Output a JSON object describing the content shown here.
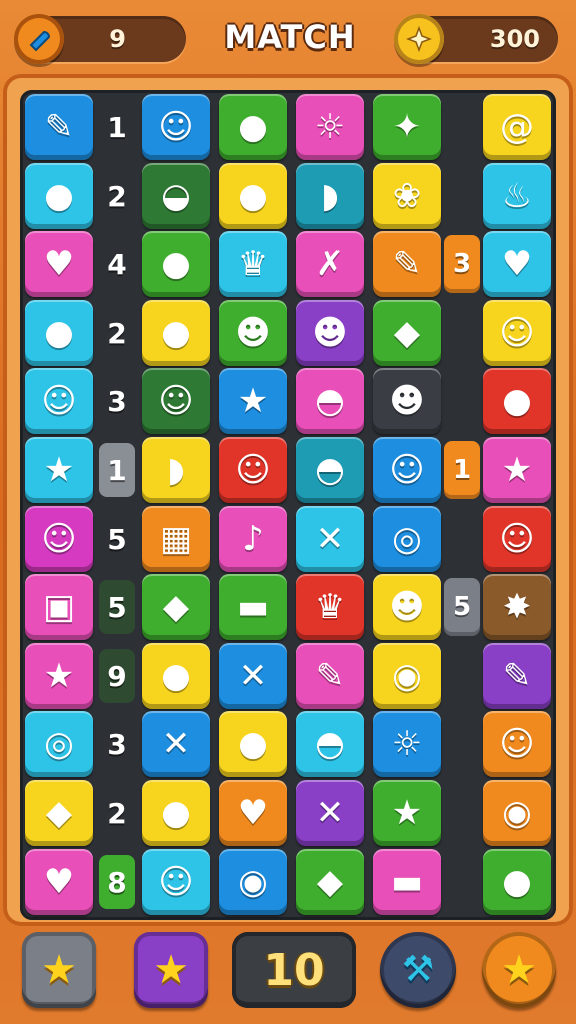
{
  "header": {
    "title": "MATCH",
    "moves_value": "9",
    "moves_icon": "wrench-icon",
    "coins_value": "300",
    "coins_icon": "coin-icon"
  },
  "colors": {
    "blue": "#1e8fe0",
    "cyan": "#2ec4e8",
    "green": "#3fae2e",
    "yellow": "#f7d41e",
    "pink": "#e94fb8",
    "magenta": "#d63ac0",
    "purple": "#8a3fc7",
    "red": "#e2352a",
    "orange": "#f08a1e",
    "darkgreen": "#2e7a34",
    "teal": "#1e9cb4",
    "dark": "#3a3e44",
    "brown": "#8a5a2a"
  },
  "board": {
    "rows": [
      {
        "tiles": [
          {
            "c": "blue",
            "g": "✎"
          },
          {
            "c": "blue",
            "g": "☺"
          },
          {
            "c": "green",
            "g": "●"
          },
          {
            "c": "pink",
            "g": "☼"
          },
          {
            "c": "green",
            "g": "✦"
          },
          {
            "c": "yellow",
            "g": "@"
          }
        ],
        "hint": "1",
        "chip": ""
      },
      {
        "tiles": [
          {
            "c": "cyan",
            "g": "●"
          },
          {
            "c": "darkgreen",
            "g": "◒"
          },
          {
            "c": "yellow",
            "g": "●"
          },
          {
            "c": "teal",
            "g": "◗"
          },
          {
            "c": "yellow",
            "g": "❀"
          },
          {
            "c": "cyan",
            "g": "♨"
          }
        ],
        "hint": "2",
        "chip": ""
      },
      {
        "tiles": [
          {
            "c": "pink",
            "g": "♥"
          },
          {
            "c": "green",
            "g": "●"
          },
          {
            "c": "cyan",
            "g": "♛"
          },
          {
            "c": "pink",
            "g": "✗"
          },
          {
            "c": "orange",
            "g": "✎"
          },
          {
            "c": "cyan",
            "g": "♥"
          }
        ],
        "hint": "4",
        "chip": "3"
      },
      {
        "tiles": [
          {
            "c": "cyan",
            "g": "●"
          },
          {
            "c": "yellow",
            "g": "●"
          },
          {
            "c": "green",
            "g": "☻"
          },
          {
            "c": "purple",
            "g": "☻"
          },
          {
            "c": "green",
            "g": "◆"
          },
          {
            "c": "yellow",
            "g": "☺"
          }
        ],
        "hint": "2",
        "chip": ""
      },
      {
        "tiles": [
          {
            "c": "cyan",
            "g": "☺"
          },
          {
            "c": "darkgreen",
            "g": "☺"
          },
          {
            "c": "blue",
            "g": "★"
          },
          {
            "c": "pink",
            "g": "◓"
          },
          {
            "c": "dark",
            "g": "☻"
          },
          {
            "c": "red",
            "g": "●"
          }
        ],
        "hint": "3",
        "chip": ""
      },
      {
        "tiles": [
          {
            "c": "cyan",
            "g": "★"
          },
          {
            "c": "yellow",
            "g": "◗"
          },
          {
            "c": "red",
            "g": "☺"
          },
          {
            "c": "teal",
            "g": "◓"
          },
          {
            "c": "blue",
            "g": "☺"
          },
          {
            "c": "pink",
            "g": "★"
          }
        ],
        "hint": "1",
        "chip": "1"
      },
      {
        "tiles": [
          {
            "c": "magenta",
            "g": "☺"
          },
          {
            "c": "orange",
            "g": "▦"
          },
          {
            "c": "pink",
            "g": "♪"
          },
          {
            "c": "cyan",
            "g": "✕"
          },
          {
            "c": "blue",
            "g": "◎"
          },
          {
            "c": "red",
            "g": "☺"
          }
        ],
        "hint": "5",
        "chip": ""
      },
      {
        "tiles": [
          {
            "c": "pink",
            "g": "▣"
          },
          {
            "c": "green",
            "g": "◆"
          },
          {
            "c": "green",
            "g": "▬"
          },
          {
            "c": "red",
            "g": "♛"
          },
          {
            "c": "yellow",
            "g": "☻"
          },
          {
            "c": "brown",
            "g": "✸"
          }
        ],
        "hint": "5",
        "chip": "5"
      },
      {
        "tiles": [
          {
            "c": "pink",
            "g": "★"
          },
          {
            "c": "yellow",
            "g": "●"
          },
          {
            "c": "blue",
            "g": "✕"
          },
          {
            "c": "pink",
            "g": "✎"
          },
          {
            "c": "yellow",
            "g": "◉"
          },
          {
            "c": "purple",
            "g": "✎"
          }
        ],
        "hint": "9",
        "chip": ""
      },
      {
        "tiles": [
          {
            "c": "cyan",
            "g": "◎"
          },
          {
            "c": "blue",
            "g": "✕"
          },
          {
            "c": "yellow",
            "g": "●"
          },
          {
            "c": "cyan",
            "g": "◓"
          },
          {
            "c": "blue",
            "g": "☼"
          },
          {
            "c": "orange",
            "g": "☺"
          }
        ],
        "hint": "3",
        "chip": ""
      },
      {
        "tiles": [
          {
            "c": "yellow",
            "g": "◆"
          },
          {
            "c": "yellow",
            "g": "●"
          },
          {
            "c": "orange",
            "g": "♥"
          },
          {
            "c": "purple",
            "g": "✕"
          },
          {
            "c": "green",
            "g": "★"
          },
          {
            "c": "orange",
            "g": "◉"
          }
        ],
        "hint": "2",
        "chip": ""
      },
      {
        "tiles": [
          {
            "c": "pink",
            "g": "♥"
          },
          {
            "c": "cyan",
            "g": "☺"
          },
          {
            "c": "blue",
            "g": "◉"
          },
          {
            "c": "green",
            "g": "◆"
          },
          {
            "c": "pink",
            "g": "▬"
          },
          {
            "c": "green",
            "g": "●"
          }
        ],
        "hint": "8",
        "chip": ""
      }
    ]
  },
  "footer": {
    "star_button_1_icon": "star-icon",
    "star_button_2_icon": "star-icon",
    "moves_left": "10",
    "hammer_button_icon": "hammer-icon",
    "star_button_3_icon": "star-icon"
  }
}
